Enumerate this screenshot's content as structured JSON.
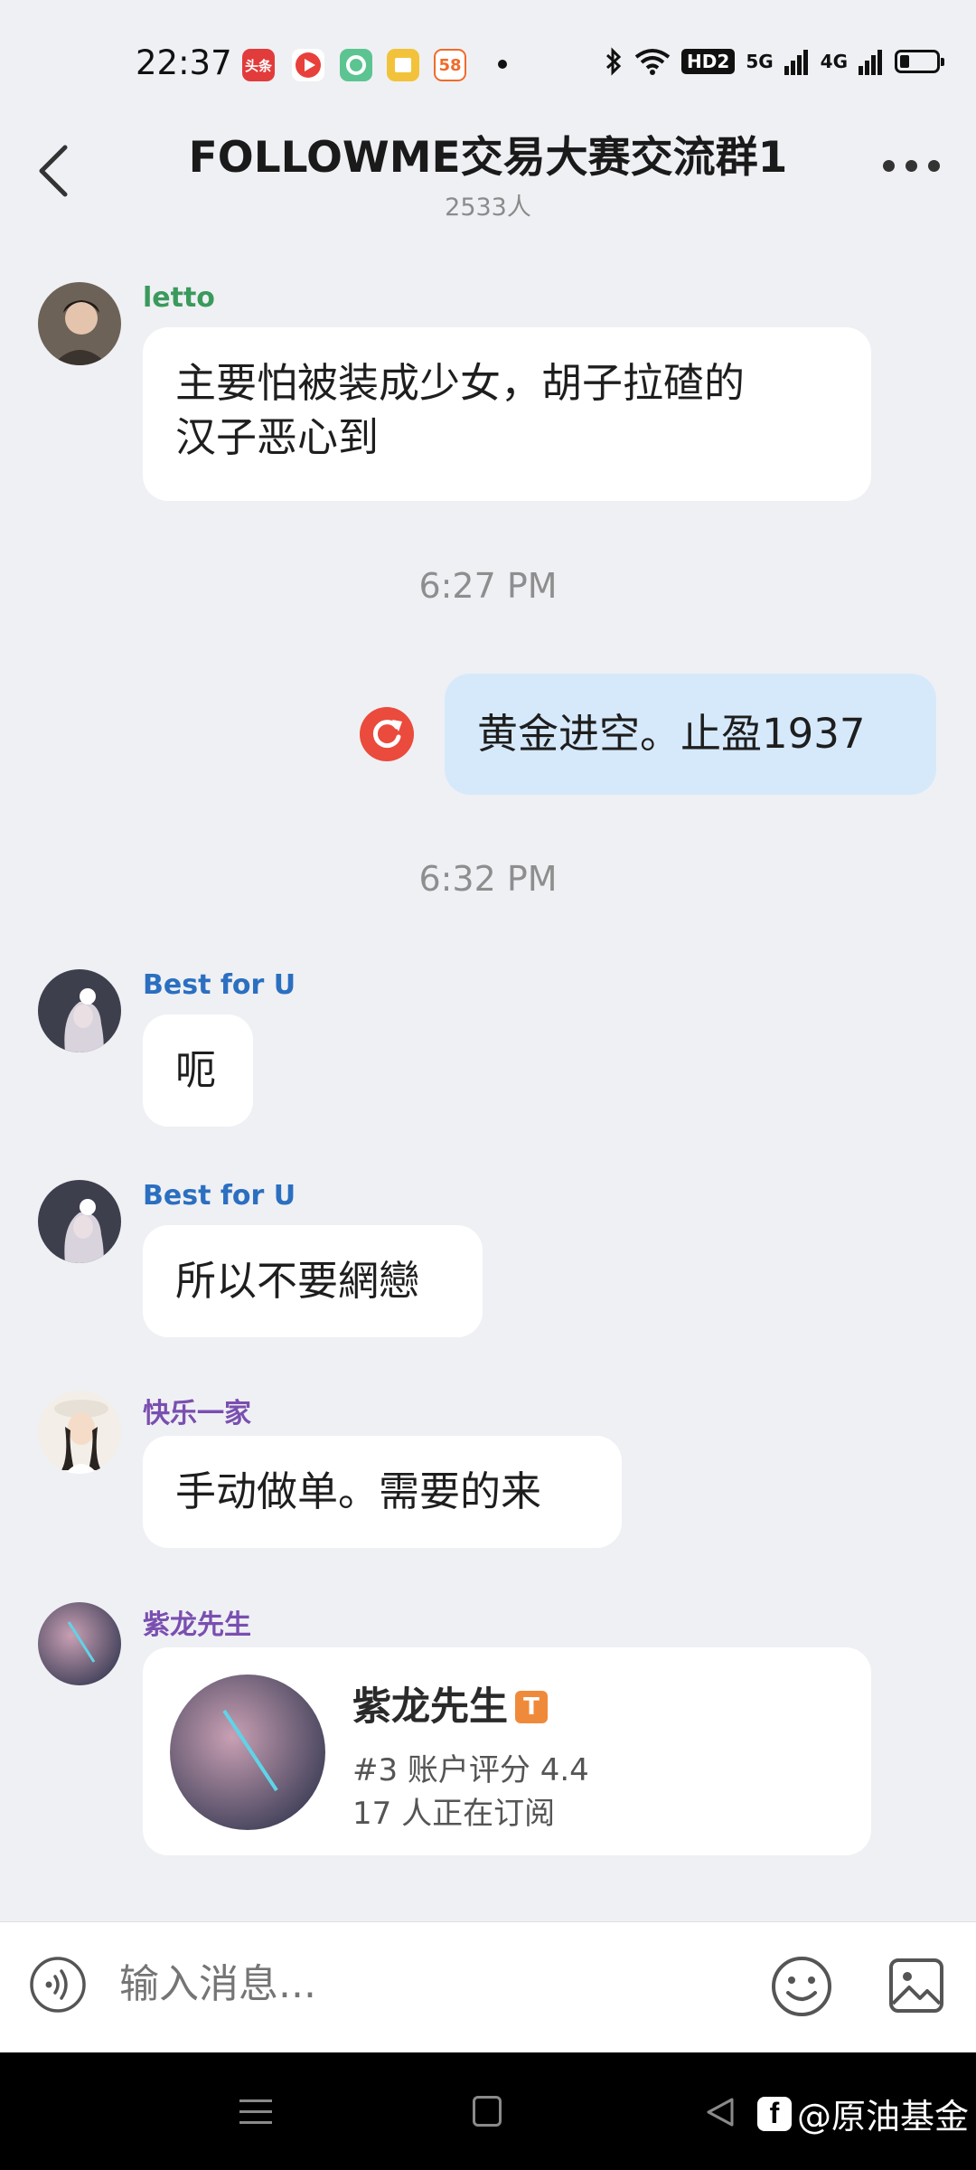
{
  "status_bar": {
    "time": "22:37",
    "app_icons": [
      {
        "name": "toutiao-icon",
        "label": "头条",
        "color": "#e23b3b"
      },
      {
        "name": "video-app-icon",
        "color": "#e8403a"
      },
      {
        "name": "green-app-icon",
        "color": "#5cc491"
      },
      {
        "name": "book-app-icon",
        "color": "#f2c33a"
      },
      {
        "name": "58-app-icon",
        "label": "58",
        "color": "#f06b2a"
      }
    ],
    "network_5g": "5G",
    "network_4g": "4G",
    "hd_label": "HD2"
  },
  "header": {
    "title": "FOLLOWME交易大赛交流群1",
    "member_count": "2533人"
  },
  "messages": [
    {
      "sender": "letto",
      "sender_color": "#3a9a5c",
      "line1": "主要怕被装成少女，胡子拉碴的",
      "line2": "汉子恶心到"
    },
    {
      "timestamp": "6:27 PM"
    },
    {
      "own_text": "黄金进空。止盈1937"
    },
    {
      "timestamp": "6:32 PM"
    },
    {
      "sender": "Best for U",
      "sender_color": "#2b6fc0",
      "text": "呃"
    },
    {
      "sender": "Best for U",
      "sender_color": "#2b6fc0",
      "text": "所以不要網戀"
    },
    {
      "sender": "快乐一家",
      "sender_color": "#7a4fb0",
      "text": "手动做单。需要的来"
    },
    {
      "sender": "紫龙先生",
      "sender_color": "#7a4fb0",
      "card": {
        "name": "紫龙先生",
        "badge": "T",
        "rank_line": "#3 账户评分 4.4",
        "subscribers_line": "17 人正在订阅"
      }
    }
  ],
  "input": {
    "placeholder": "输入消息..."
  },
  "navbar": {
    "watermark": "@原油基金",
    "fb_label": "f"
  }
}
